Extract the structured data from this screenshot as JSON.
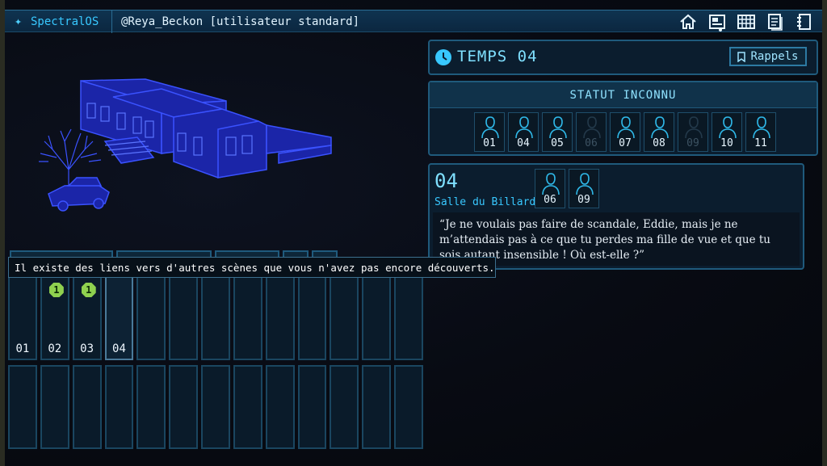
{
  "topbar": {
    "app_name": "SpectralOS",
    "user": "@Reya_Beckon [utilisateur standard]",
    "nav_icons": [
      "home-icon",
      "scene-view-icon",
      "grid-icon",
      "documents-icon",
      "notebook-icon"
    ]
  },
  "temps": {
    "title": "TEMPS 04",
    "rappels_label": "Rappels"
  },
  "statut": {
    "title": "STATUT INCONNU",
    "people": [
      {
        "num": "01",
        "known": true
      },
      {
        "num": "04",
        "known": true
      },
      {
        "num": "05",
        "known": true
      },
      {
        "num": "06",
        "known": false
      },
      {
        "num": "07",
        "known": true
      },
      {
        "num": "08",
        "known": true
      },
      {
        "num": "09",
        "known": false
      },
      {
        "num": "10",
        "known": true
      },
      {
        "num": "11",
        "known": true
      }
    ]
  },
  "salle": {
    "number": "04",
    "name": "Salle du Billard",
    "people": [
      "06",
      "09"
    ],
    "quote": "“Je ne voulais pas faire de scandale, Eddie, mais je ne m’attendais pas à ce que tu perdes ma fille de vue et que tu sois autant insensible ! Où est-elle ?”"
  },
  "tooltip": "Il existe des liens vers d'autres scènes que vous n'avez pas encore découverts.",
  "scenes": {
    "row1": [
      {
        "num": "01",
        "badge": ""
      },
      {
        "num": "02",
        "badge": "1"
      },
      {
        "num": "03",
        "badge": "1"
      },
      {
        "num": "04",
        "badge": "",
        "active": true
      },
      {
        "num": "",
        "badge": ""
      },
      {
        "num": "",
        "badge": ""
      },
      {
        "num": "",
        "badge": ""
      },
      {
        "num": "",
        "badge": ""
      },
      {
        "num": "",
        "badge": ""
      },
      {
        "num": "",
        "badge": ""
      },
      {
        "num": "",
        "badge": ""
      },
      {
        "num": "",
        "badge": ""
      },
      {
        "num": "",
        "badge": ""
      }
    ],
    "row2_count": 13
  },
  "colors": {
    "accent": "#38c8ff",
    "panel_border": "#1f5a7c",
    "badge_green": "#8fd14f",
    "model_blue": "#2a3cff"
  }
}
